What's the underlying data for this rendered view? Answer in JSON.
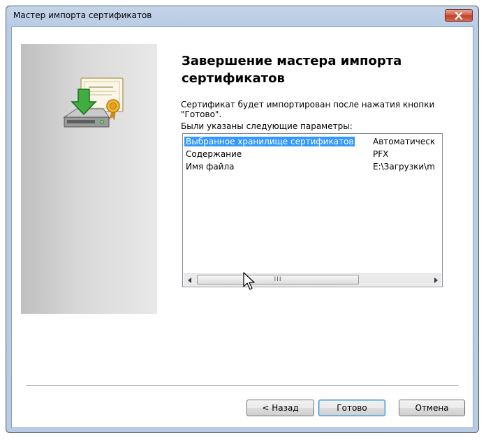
{
  "window": {
    "title": "Мастер импорта сертификатов"
  },
  "heading": "Завершение мастера импорта сертификатов",
  "description": "Сертификат будет импортирован после нажатия кнопки \"Готово\".",
  "params_label": "Были указаны следующие параметры:",
  "params": [
    {
      "name": "Выбранное хранилище сертификатов",
      "value": "Автоматическ",
      "selected": true
    },
    {
      "name": "Содержание",
      "value": "PFX",
      "selected": false
    },
    {
      "name": "Имя файла",
      "value": "E:\\Загрузки\\m",
      "selected": false
    }
  ],
  "scrollbar": {
    "grip": "III"
  },
  "buttons": {
    "back": "< Назад",
    "finish": "Готово",
    "cancel": "Отмена"
  },
  "icons": {
    "close": "close-icon",
    "wizard": "certificate-install-icon"
  },
  "colors": {
    "selection": "#3399ff",
    "titlebar": "#b9cde6",
    "close_button": "#c8452e"
  }
}
